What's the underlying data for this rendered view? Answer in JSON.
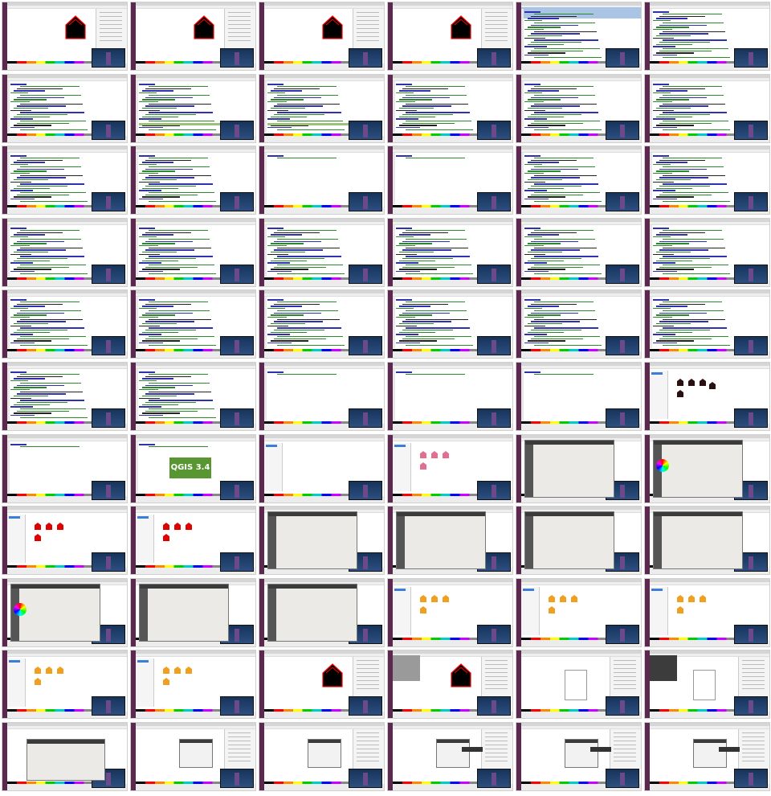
{
  "meta": {
    "rows": 11,
    "cols": 6
  },
  "splash_text": "QGIS 3.4",
  "palette_colors": [
    "#000000",
    "#ff0000",
    "#ff8800",
    "#ffff00",
    "#00cc00",
    "#00cccc",
    "#0000ff",
    "#cc00ff",
    "#888888",
    "#ff66cc",
    "#996633",
    "#ffffff"
  ],
  "accent_colors": {
    "launcher": "#5e2750",
    "selection": "#3b7dd8",
    "qgis_green": "#589632",
    "marker_red": "#e00000",
    "marker_pink": "#e07090",
    "marker_orange": "#f0a020",
    "house_fill": "#000000",
    "house_stroke": "#ff0000"
  },
  "tiles": [
    {
      "kind": "house",
      "icon": "house-icon"
    },
    {
      "kind": "house",
      "icon": "house-icon"
    },
    {
      "kind": "house",
      "icon": "house-icon"
    },
    {
      "kind": "house",
      "icon": "house-icon"
    },
    {
      "kind": "code-select",
      "icon": "code-icon"
    },
    {
      "kind": "code",
      "icon": "code-icon"
    },
    {
      "kind": "code",
      "icon": "code-icon"
    },
    {
      "kind": "code-hl",
      "icon": "code-icon"
    },
    {
      "kind": "code-hl",
      "icon": "code-icon"
    },
    {
      "kind": "code",
      "icon": "code-icon"
    },
    {
      "kind": "code",
      "icon": "code-icon"
    },
    {
      "kind": "code",
      "icon": "code-icon"
    },
    {
      "kind": "code",
      "icon": "code-icon"
    },
    {
      "kind": "code",
      "icon": "code-icon"
    },
    {
      "kind": "code-empty",
      "icon": "code-icon"
    },
    {
      "kind": "code-empty",
      "icon": "code-icon"
    },
    {
      "kind": "code",
      "icon": "code-icon"
    },
    {
      "kind": "code",
      "icon": "code-icon"
    },
    {
      "kind": "code",
      "icon": "code-icon"
    },
    {
      "kind": "code",
      "icon": "code-icon"
    },
    {
      "kind": "code",
      "icon": "code-icon"
    },
    {
      "kind": "code",
      "icon": "code-icon"
    },
    {
      "kind": "code",
      "icon": "code-icon"
    },
    {
      "kind": "code",
      "icon": "code-icon"
    },
    {
      "kind": "code",
      "icon": "code-icon"
    },
    {
      "kind": "code",
      "icon": "code-icon"
    },
    {
      "kind": "code",
      "icon": "code-icon"
    },
    {
      "kind": "code",
      "icon": "code-icon"
    },
    {
      "kind": "code",
      "icon": "code-icon"
    },
    {
      "kind": "code",
      "icon": "code-icon"
    },
    {
      "kind": "code",
      "icon": "code-icon"
    },
    {
      "kind": "code",
      "icon": "code-icon"
    },
    {
      "kind": "code-empty",
      "icon": "code-icon"
    },
    {
      "kind": "code-empty",
      "icon": "code-icon"
    },
    {
      "kind": "code-empty",
      "icon": "code-icon"
    },
    {
      "kind": "markers-dark",
      "icon": "marker-icon"
    },
    {
      "kind": "code-empty",
      "icon": "code-icon"
    },
    {
      "kind": "splash",
      "icon": "qgis-logo-icon"
    },
    {
      "kind": "blank-map",
      "icon": "map-icon"
    },
    {
      "kind": "markers-pink",
      "icon": "marker-icon"
    },
    {
      "kind": "dialog",
      "icon": "style-dialog-icon"
    },
    {
      "kind": "dialog-wheel",
      "icon": "color-wheel-icon"
    },
    {
      "kind": "markers-red",
      "icon": "marker-icon"
    },
    {
      "kind": "markers-red",
      "icon": "marker-icon"
    },
    {
      "kind": "dialog",
      "icon": "style-dialog-icon"
    },
    {
      "kind": "dialog",
      "icon": "style-dialog-icon"
    },
    {
      "kind": "dialog",
      "icon": "style-dialog-icon"
    },
    {
      "kind": "dialog",
      "icon": "style-dialog-icon"
    },
    {
      "kind": "dialog-wheel",
      "icon": "color-wheel-icon"
    },
    {
      "kind": "dialog",
      "icon": "style-dialog-icon"
    },
    {
      "kind": "dialog",
      "icon": "style-dialog-icon"
    },
    {
      "kind": "markers-orange",
      "icon": "marker-icon"
    },
    {
      "kind": "markers-orange",
      "icon": "marker-icon"
    },
    {
      "kind": "markers-orange",
      "icon": "marker-icon"
    },
    {
      "kind": "markers-orange",
      "icon": "marker-icon"
    },
    {
      "kind": "markers-orange",
      "icon": "marker-icon"
    },
    {
      "kind": "house",
      "icon": "house-icon"
    },
    {
      "kind": "house-greymenu",
      "icon": "house-icon"
    },
    {
      "kind": "page",
      "icon": "page-icon"
    },
    {
      "kind": "page-darkmenu",
      "icon": "page-icon"
    },
    {
      "kind": "big-dialog",
      "icon": "dialog-icon"
    },
    {
      "kind": "small-dialog",
      "icon": "dialog-icon"
    },
    {
      "kind": "small-dialog",
      "icon": "dialog-icon"
    },
    {
      "kind": "small-dialog-tip",
      "icon": "dialog-icon"
    },
    {
      "kind": "small-dialog-tip",
      "icon": "dialog-icon"
    },
    {
      "kind": "small-dialog-tip",
      "icon": "dialog-icon"
    }
  ]
}
